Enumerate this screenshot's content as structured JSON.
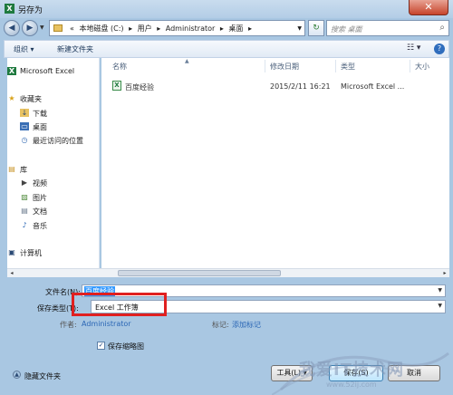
{
  "window": {
    "title": "另存为",
    "close_glyph": "✕"
  },
  "nav": {
    "back_glyph": "◀",
    "forward_glyph": "▶",
    "refresh_glyph": "↻",
    "breadcrumbs": [
      "«",
      "本地磁盘 (C:)",
      "▸",
      "用户",
      "▸",
      "Administrator",
      "▸",
      "桌面",
      "▸"
    ],
    "search_placeholder": "搜索 桌面",
    "search_icon": "search-icon"
  },
  "toolbar": {
    "organize": "组织 ▾",
    "new_folder": "新建文件夹",
    "view_glyph": "☷ ▾",
    "help_glyph": "?"
  },
  "sidebar": {
    "items": [
      {
        "label": "Microsoft Excel",
        "icon": "excel-icon",
        "glyph": "X",
        "indent": false
      },
      {
        "label": "收藏夹",
        "icon": "star-icon",
        "glyph": "★",
        "indent": false
      },
      {
        "label": "下载",
        "icon": "download-folder-icon",
        "glyph": "↓",
        "indent": true
      },
      {
        "label": "桌面",
        "icon": "desktop-icon",
        "glyph": "▭",
        "indent": true
      },
      {
        "label": "最近访问的位置",
        "icon": "recent-icon",
        "glyph": "◷",
        "indent": true
      },
      {
        "label": "库",
        "icon": "library-icon",
        "glyph": "▤",
        "indent": false
      },
      {
        "label": "视频",
        "icon": "video-icon",
        "glyph": "▶",
        "indent": true
      },
      {
        "label": "图片",
        "icon": "picture-icon",
        "glyph": "▨",
        "indent": true
      },
      {
        "label": "文档",
        "icon": "document-icon",
        "glyph": "▤",
        "indent": true
      },
      {
        "label": "音乐",
        "icon": "music-icon",
        "glyph": "♪",
        "indent": true
      },
      {
        "label": "计算机",
        "icon": "computer-icon",
        "glyph": "▣",
        "indent": false
      }
    ]
  },
  "filelist": {
    "columns": {
      "name": "名称",
      "modified": "修改日期",
      "type": "类型",
      "size": "大小"
    },
    "rows": [
      {
        "name": "百度经验",
        "modified": "2015/2/11 16:21",
        "type": "Microsoft Excel ...",
        "icon": "excel-file-icon",
        "glyph": "X"
      }
    ]
  },
  "form": {
    "filename_label": "文件名(N):",
    "filename_value": "百度经验",
    "filetype_label": "保存类型(T):",
    "filetype_value": "Excel 工作簿",
    "author_label": "作者:",
    "author_value": "Administrator",
    "tags_label": "标记:",
    "tags_value": "添加标记",
    "thumbnail_label": "保存缩略图",
    "thumbnail_checked": "✓"
  },
  "footer": {
    "hide_folders": "隐藏文件夹",
    "tools": "工具(L) ▾",
    "save": "保存(S)",
    "cancel": "取消"
  },
  "watermark": {
    "text": "我爱IT技术网",
    "url": "www.52ij.com"
  },
  "colors": {
    "highlight": "#e02020",
    "accent": "#3399ff"
  }
}
